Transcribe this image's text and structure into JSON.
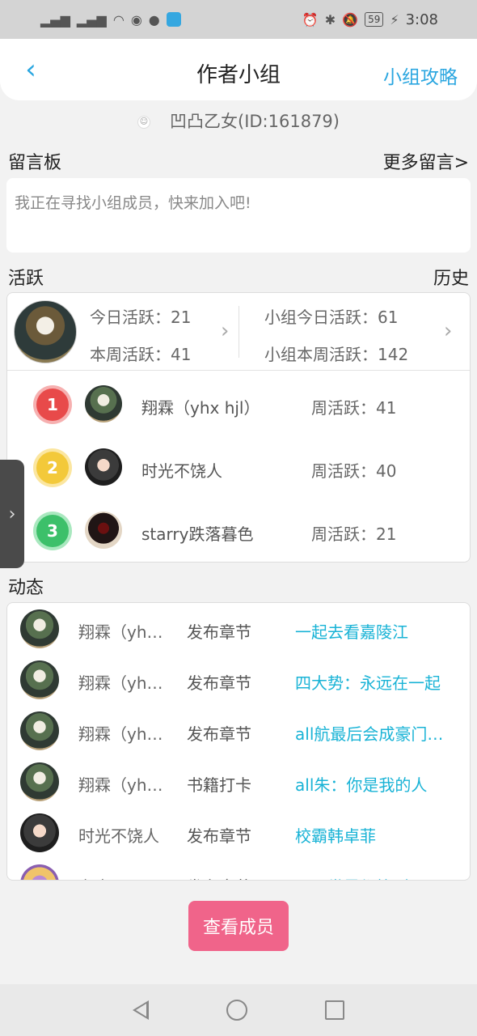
{
  "statusbar": {
    "signal1": "46",
    "time": "3:08",
    "battery": "59"
  },
  "header": {
    "title": "作者小组",
    "guide_label": "小组攻略"
  },
  "owner": {
    "label": "凹凸乙女(ID:161879)"
  },
  "message_board": {
    "title": "留言板",
    "more_label": "更多留言>",
    "content": "我正在寻找小组成员，快来加入吧!"
  },
  "active": {
    "title": "活跃",
    "history_label": "历史",
    "today": "今日活跃：21",
    "week": "本周活跃：41",
    "group_today": "小组今日活跃：61",
    "group_week": "小组本周活跃：142",
    "ranking": [
      {
        "rank": "1",
        "name": "翔霖（yhx hjl）",
        "weekly": "周活跃：41"
      },
      {
        "rank": "2",
        "name": "时光不饶人",
        "weekly": "周活跃：40"
      },
      {
        "rank": "3",
        "name": "starry跌落暮色",
        "weekly": "周活跃：21"
      }
    ]
  },
  "feed": {
    "title": "动态",
    "items": [
      {
        "name": "翔霖（yhx hjl）",
        "action": "发布章节",
        "target": "一起去看嘉陵江"
      },
      {
        "name": "翔霖（yhx hjl）",
        "action": "发布章节",
        "target": "四大势：永远在一起"
      },
      {
        "name": "翔霖（yhx hjl）",
        "action": "发布章节",
        "target": "all航最后会成豪门少爷"
      },
      {
        "name": "翔霖（yhx hjl）",
        "action": "书籍打卡",
        "target": "all朱：你是我的人"
      },
      {
        "name": "时光不饶人",
        "action": "发布章节",
        "target": "校霸韩卓菲"
      },
      {
        "name": "老童",
        "action": "发布章节",
        "target": "明月世界都校（"
      }
    ]
  },
  "view_members_label": "查看成员",
  "colors": {
    "accent": "#2aa6e0",
    "link": "#19b3d6",
    "button": "#f0648a"
  }
}
